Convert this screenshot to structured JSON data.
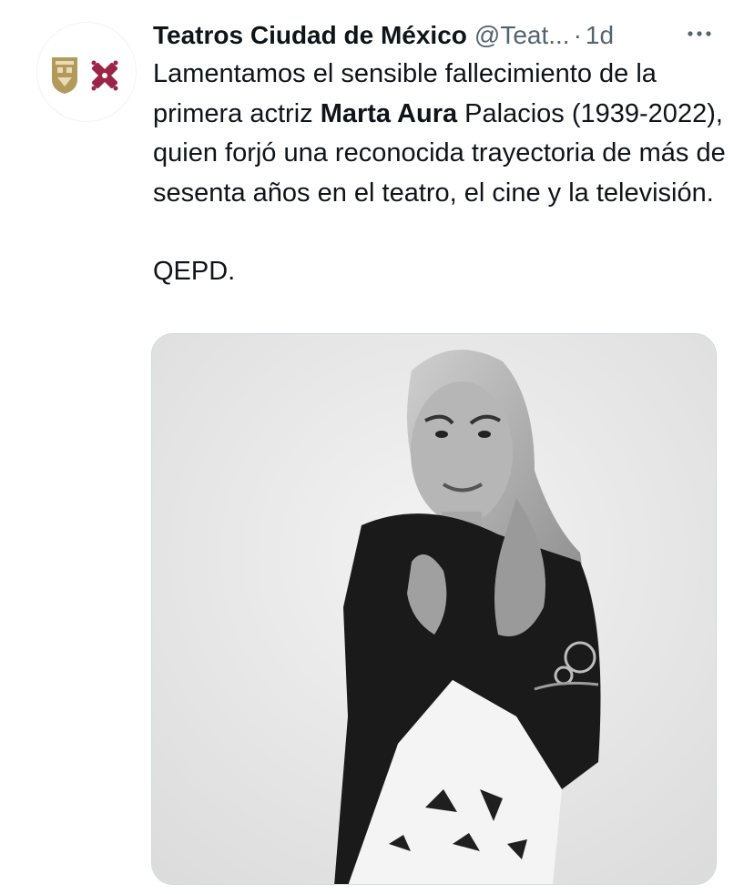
{
  "tweet": {
    "author_name": "Teatros Ciudad de México",
    "author_handle": "@Teat...",
    "separator": "·",
    "timestamp": "1d",
    "avatar_icon": "cdmx-government-logo",
    "more_icon": "more-options-icon",
    "text": {
      "line1_prefix": "Lamentamos el sensible fallecimiento de la primera actriz ",
      "bold_name": "Marta Aura",
      "line1_suffix": " Palacios (1939-2022), quien forjó una reconocida trayectoria de más de sesenta años en el teatro, el cine y la televisión.",
      "closing": "QEPD."
    },
    "media": {
      "type": "photo",
      "description_kind": "black-and-white portrait"
    }
  },
  "colors": {
    "text_primary": "#0f1419",
    "text_secondary": "#536471",
    "border": "#cfd9de",
    "logo_gold": "#b49a5a",
    "logo_maroon": "#9d2449"
  }
}
